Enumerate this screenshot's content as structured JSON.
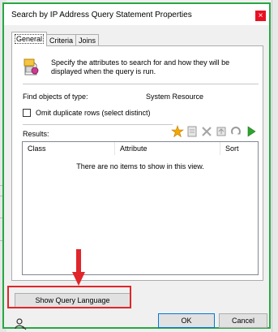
{
  "window": {
    "title": "Search by IP Address Query Statement Properties",
    "close_glyph": "×"
  },
  "tabs": [
    {
      "label": "General",
      "active": true
    },
    {
      "label": "Criteria",
      "active": false
    },
    {
      "label": "Joins",
      "active": false
    }
  ],
  "general": {
    "description": "Specify the attributes to search for and how they will be displayed when the query is run.",
    "find_label": "Find objects of type:",
    "find_value": "System Resource",
    "omit_duplicates_label": "Omit duplicate rows (select distinct)",
    "omit_duplicates_checked": false,
    "results_label": "Results:",
    "toolbar_icons": [
      "new-star-icon",
      "properties-icon",
      "delete-icon",
      "move-up-icon",
      "move-down-icon",
      "run-arrow-icon"
    ],
    "columns": [
      "Class",
      "Attribute",
      "Sort"
    ],
    "empty_message": "There are no items to show in this view."
  },
  "footer": {
    "show_query_label": "Show Query Language",
    "ok_label": "OK",
    "cancel_label": "Cancel"
  },
  "annotation": {
    "highlight_color": "#e0262a",
    "arrow_color": "#e0262a",
    "window_border_color": "#27a844"
  }
}
